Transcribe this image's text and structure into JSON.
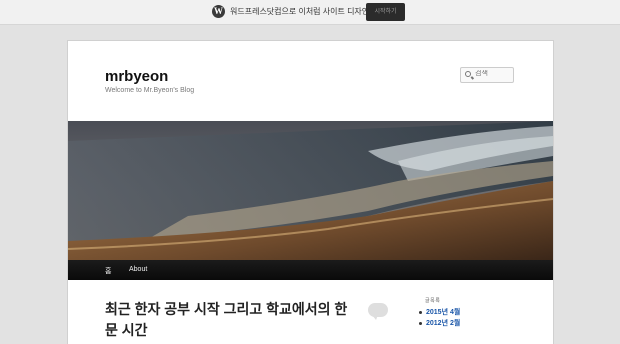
{
  "promo": {
    "text": "워드프레스닷컴으로 이처럼 사이트 디자인",
    "button": "시작하기"
  },
  "site": {
    "title": "mrbyeon",
    "description": "Welcome to Mr.Byeon's Blog"
  },
  "search": {
    "placeholder": "검색",
    "icon": "search-icon"
  },
  "nav": {
    "home": "홈",
    "about": "About"
  },
  "post": {
    "title": "최근 한자 공부 시작 그리고 학교에서의 한문 시간"
  },
  "sidebar": {
    "widget_title": "글목록",
    "archives": [
      "2015년 4월",
      "2012년 2월"
    ]
  }
}
